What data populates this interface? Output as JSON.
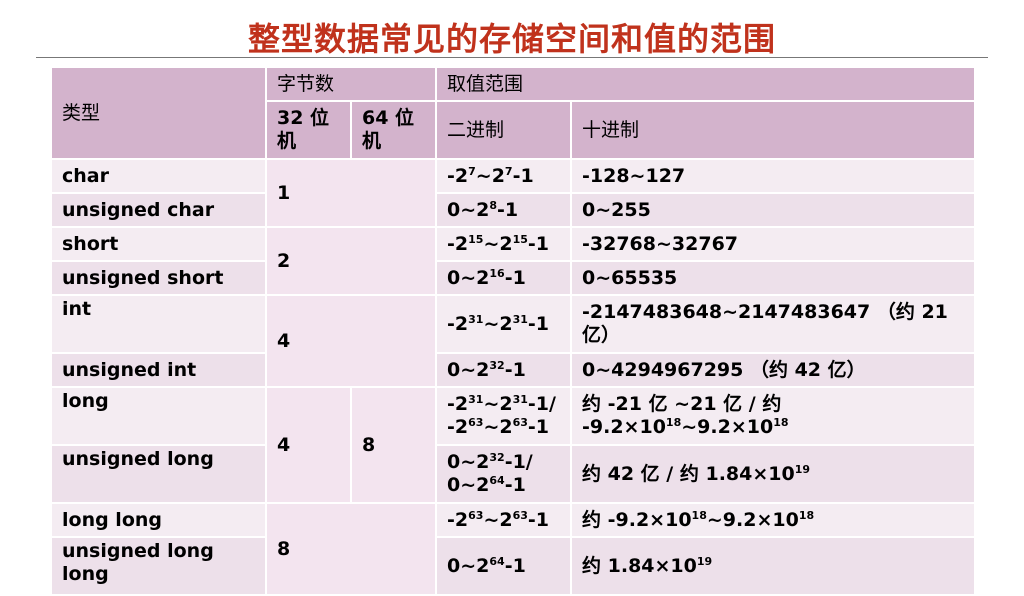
{
  "title": "整型数据常见的存储空间和值的范围",
  "headers": {
    "type": "类型",
    "bytes": "字节数",
    "range": "取值范围",
    "bit32": "32 位机",
    "bit64": "64 位机",
    "binary": "二进制",
    "decimal": "十进制"
  },
  "rows": [
    {
      "type": "char",
      "bytes": "1",
      "bin_html": "-2<sup>7</sup>~2<sup>7</sup>-1",
      "dec_html": "-128~127"
    },
    {
      "type": "unsigned char",
      "bin_html": "0~2<sup>8</sup>-1",
      "dec_html": "0~255"
    },
    {
      "type": "short",
      "bytes": "2",
      "bin_html": "-2<sup>15</sup>~2<sup>15</sup>-1",
      "dec_html": "-32768~32767"
    },
    {
      "type": "unsigned short",
      "bin_html": "0~2<sup>16</sup>-1",
      "dec_html": "0~65535"
    },
    {
      "type": "int",
      "bytes": "4",
      "bin_html": "-2<sup>31</sup>~2<sup>31</sup>-1",
      "dec_html": "-2147483648~2147483647 （约 21 亿）"
    },
    {
      "type": "unsigned int",
      "bin_html": "0~2<sup>32</sup>-1",
      "dec_html": "0~4294967295 （约 42 亿）"
    },
    {
      "type": "long",
      "bytes32": "4",
      "bytes64": "8",
      "bin_html": "-2<sup>31</sup>~2<sup>31</sup>-1/ -2<sup>63</sup>~2<sup>63</sup>-1",
      "dec_html": "约 -21 亿 ~21 亿 / 约 -9.2×10<sup>18</sup>~9.2×10<sup>18</sup>"
    },
    {
      "type": "unsigned long",
      "bin_html": "0~2<sup>32</sup>-1/ 0~2<sup>64</sup>-1",
      "dec_html": "约 42 亿 / 约 1.84×10<sup>19</sup>"
    },
    {
      "type": "long long",
      "bytes": "8",
      "bin_html": "-2<sup>63</sup>~2<sup>63</sup>-1",
      "dec_html": "约 -9.2×10<sup>18</sup>~9.2×10<sup>18</sup>"
    },
    {
      "type": "unsigned long long",
      "bin_html": "0~2<sup>64</sup>-1",
      "dec_html": "约 1.84×10<sup>19</sup>"
    }
  ]
}
